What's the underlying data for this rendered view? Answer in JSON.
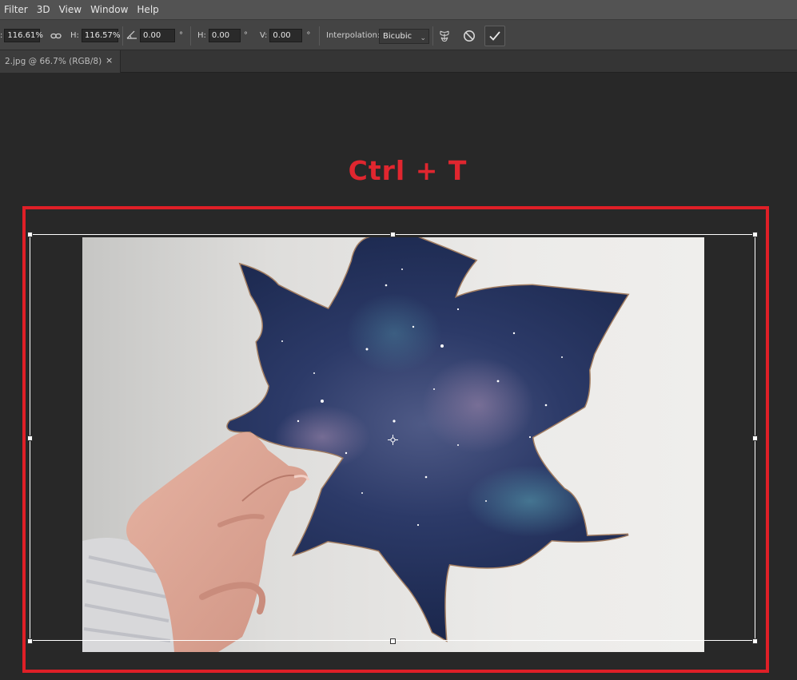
{
  "menu": [
    "Filter",
    "3D",
    "View",
    "Window",
    "Help"
  ],
  "options": {
    "w_value": "116.61%",
    "h_label": "H:",
    "h_value": "116.57%",
    "angle_value": "0.00",
    "degree_symbol": "°",
    "skew_h_label": "H:",
    "skew_h_value": "0.00",
    "skew_v_label": "V:",
    "skew_v_value": "0.00",
    "interpolation_label": "Interpolation:",
    "interpolation_value": "Bicubic",
    "icons": [
      "link-icon",
      "angle-icon",
      "warp-icon",
      "cancel-icon",
      "commit-icon"
    ]
  },
  "document_tab": {
    "title": "2.jpg @ 66.7% (RGB/8)",
    "close": "×"
  },
  "caption": "Ctrl + T",
  "colors": {
    "accent_red": "#df1f27",
    "menu_bar": "#535353",
    "options_bar": "#444444",
    "canvas_bg": "#282828"
  }
}
